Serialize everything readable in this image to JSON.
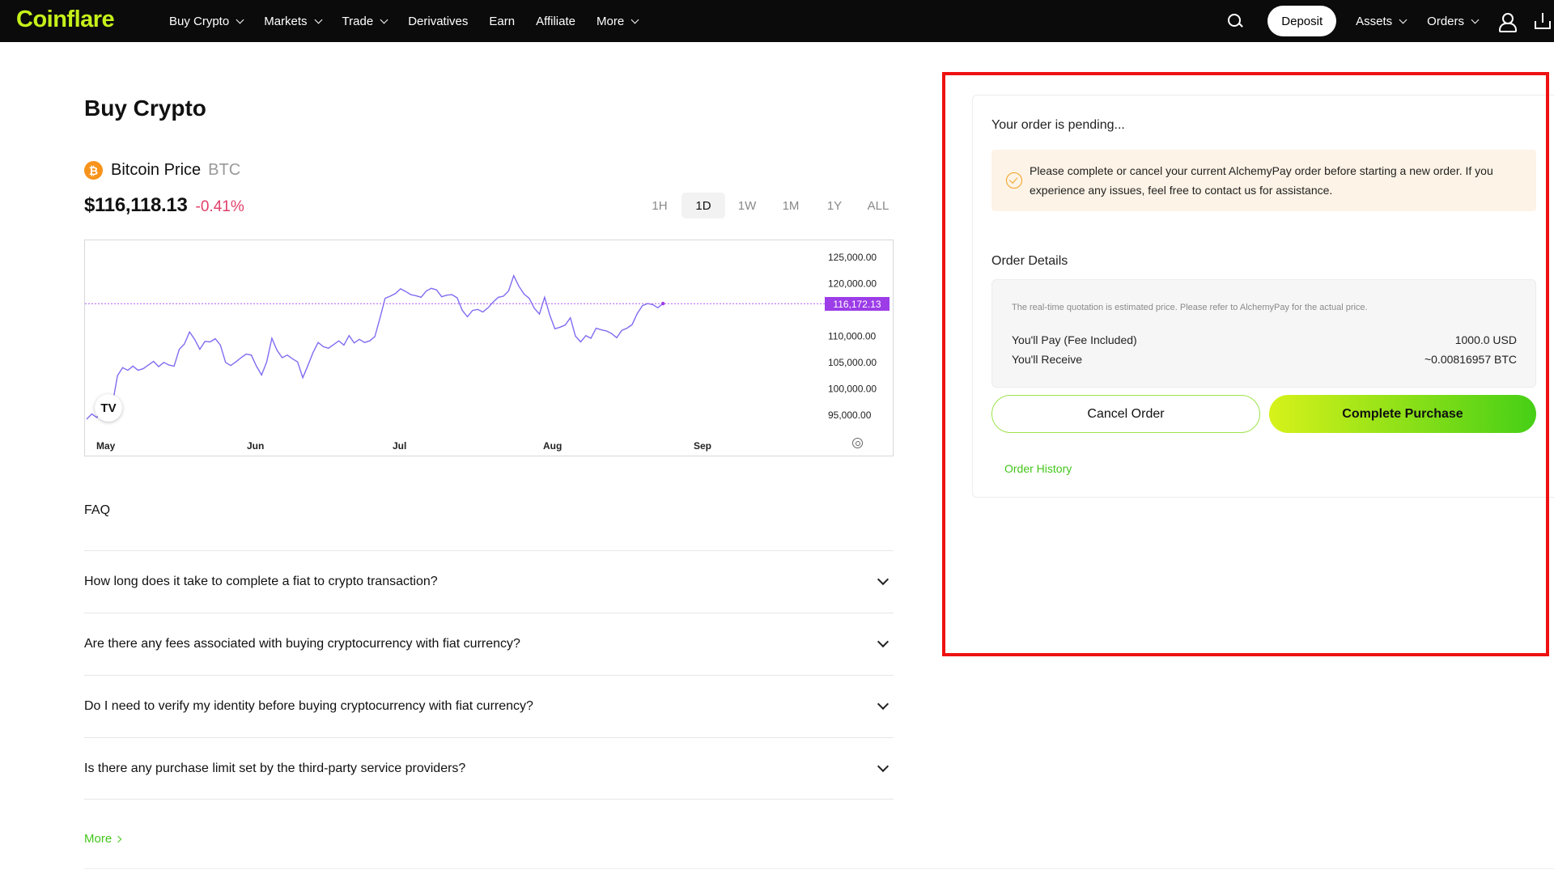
{
  "nav": {
    "logo": "Coinflare",
    "items": [
      {
        "label": "Buy Crypto",
        "dropdown": true
      },
      {
        "label": "Markets",
        "dropdown": true
      },
      {
        "label": "Trade",
        "dropdown": true
      },
      {
        "label": "Derivatives",
        "dropdown": false
      },
      {
        "label": "Earn",
        "dropdown": false
      },
      {
        "label": "Affiliate",
        "dropdown": false
      },
      {
        "label": "More",
        "dropdown": true
      }
    ],
    "deposit_label": "Deposit",
    "assets_label": "Assets",
    "orders_label": "Orders",
    "icons": [
      "search-icon",
      "user-icon",
      "download-icon"
    ]
  },
  "page": {
    "title": "Buy Crypto",
    "coin_name": "Bitcoin Price",
    "coin_symbol": "BTC",
    "coin_icon_glyph": "₿",
    "price": "$116,118.13",
    "change": "-0.41%",
    "range_tabs": [
      "1H",
      "1D",
      "1W",
      "1M",
      "1Y",
      "ALL"
    ],
    "active_range": "1D",
    "tv_logo": "TV"
  },
  "chart_data": {
    "type": "line",
    "x_labels": [
      "May",
      "Jun",
      "Jul",
      "Aug",
      "Sep"
    ],
    "y_ticks": [
      "125,000.00",
      "120,000.00",
      "116,172.13",
      "110,000.00",
      "105,000.00",
      "100,000.00",
      "95,000.00"
    ],
    "ylim": [
      92500,
      127000
    ],
    "current_price_label": "116,172.13",
    "current_price": 116172.13,
    "values": [
      94200,
      95200,
      94500,
      96500,
      97300,
      97000,
      102500,
      104000,
      103500,
      104300,
      103500,
      103800,
      104500,
      105200,
      104200,
      105000,
      104500,
      104300,
      107500,
      108500,
      110800,
      109400,
      107500,
      109000,
      108900,
      109500,
      108300,
      105000,
      104400,
      105100,
      105900,
      106600,
      106400,
      104300,
      102600,
      105100,
      109600,
      107300,
      105900,
      106400,
      105700,
      105100,
      102100,
      104400,
      106900,
      108800,
      108000,
      107700,
      108400,
      109100,
      108300,
      110100,
      108700,
      109400,
      108800,
      109100,
      109900,
      113400,
      117200,
      117600,
      118100,
      119000,
      118500,
      117900,
      117700,
      117400,
      118600,
      119100,
      118800,
      117500,
      117800,
      117900,
      117300,
      114900,
      113700,
      114900,
      115100,
      114600,
      115400,
      116500,
      117400,
      117600,
      118600,
      121500,
      119500,
      118000,
      117200,
      115300,
      114200,
      117400,
      114000,
      111400,
      111700,
      112100,
      113500,
      110000,
      108900,
      110100,
      109600,
      111500,
      111200,
      111000,
      110500,
      109700,
      111100,
      111500,
      112200,
      114300,
      115800,
      116200,
      116000,
      115400,
      116200
    ]
  },
  "faq": {
    "title": "FAQ",
    "questions": [
      "How long does it take to complete a fiat to crypto transaction?",
      "Are there any fees associated with buying cryptocurrency with fiat currency?",
      "Do I need to verify my identity before buying cryptocurrency with fiat currency?",
      "Is there any purchase limit set by the third-party service providers?"
    ],
    "more_label": "More"
  },
  "order": {
    "pending_title": "Your order is pending...",
    "notice": "Please complete or cancel your current AlchemyPay order before starting a new order. If you experience any issues, feel free to contact us for assistance.",
    "details_title": "Order Details",
    "quote_note": "The real-time quotation is estimated price. Please refer to AlchemyPay for the actual price.",
    "pay_label": "You'll Pay (Fee Included)",
    "pay_value": "1000.0 USD",
    "receive_label": "You'll Receive",
    "receive_value": "~0.00816957 BTC",
    "cancel_label": "Cancel Order",
    "complete_label": "Complete Purchase",
    "history_label": "Order History"
  },
  "colors": {
    "brand": "#c6f01a",
    "accent_green": "#43c61a",
    "negative": "#e0406a",
    "chart_line": "#9c5cf0",
    "highlight_box": "#ee1111"
  }
}
